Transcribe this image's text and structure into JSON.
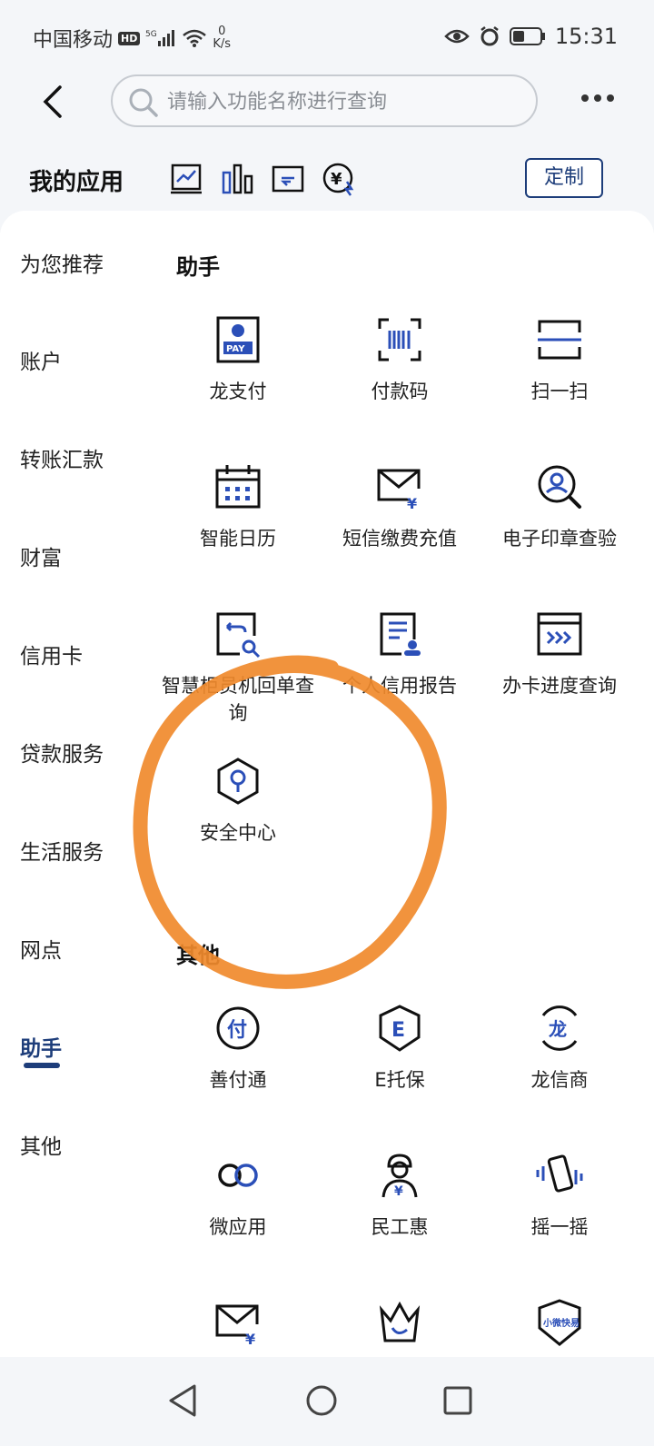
{
  "status_bar": {
    "carrier": "中国移动",
    "hd": "HD",
    "net_speed_value": "0",
    "net_speed_unit": "K/s",
    "time": "15:31"
  },
  "search": {
    "placeholder": "请输入功能名称进行查询"
  },
  "my_apps": {
    "title": "我的应用",
    "customize_label": "定制",
    "quick_icons": [
      "chart-line-icon",
      "bar-chart-icon",
      "transfer-icon",
      "yuan-exchange-icon"
    ]
  },
  "sidebar": {
    "items": [
      {
        "label": "为您推荐"
      },
      {
        "label": "账户"
      },
      {
        "label": "转账汇款"
      },
      {
        "label": "财富"
      },
      {
        "label": "信用卡"
      },
      {
        "label": "贷款服务"
      },
      {
        "label": "生活服务"
      },
      {
        "label": "网点"
      },
      {
        "label": "助手",
        "active": true
      },
      {
        "label": "其他"
      }
    ]
  },
  "sections": {
    "assistant": {
      "title": "助手",
      "items": [
        {
          "label": "龙支付",
          "icon": "long-pay-icon"
        },
        {
          "label": "付款码",
          "icon": "barcode-scan-icon"
        },
        {
          "label": "扫一扫",
          "icon": "scan-icon"
        },
        {
          "label": "智能日历",
          "icon": "calendar-icon"
        },
        {
          "label": "短信缴费充值",
          "icon": "sms-payment-icon"
        },
        {
          "label": "电子印章查验",
          "icon": "seal-verify-icon"
        },
        {
          "label": "智慧柜员机回单查询",
          "icon": "receipt-search-icon"
        },
        {
          "label": "个人信用报告",
          "icon": "credit-report-icon"
        },
        {
          "label": "办卡进度查询",
          "icon": "card-progress-icon"
        },
        {
          "label": "安全中心",
          "icon": "security-center-icon"
        }
      ]
    },
    "other": {
      "title": "其他",
      "items": [
        {
          "label": "善付通",
          "icon": "shanfutong-icon"
        },
        {
          "label": "E托保",
          "icon": "e-tuobao-icon"
        },
        {
          "label": "龙信商",
          "icon": "longxinshang-icon"
        },
        {
          "label": "微应用",
          "icon": "micro-app-icon"
        },
        {
          "label": "民工惠",
          "icon": "worker-icon"
        },
        {
          "label": "摇一摇",
          "icon": "shake-icon"
        },
        {
          "label": "",
          "icon": "mail-yuan-icon"
        },
        {
          "label": "",
          "icon": "crown-icon"
        },
        {
          "label": "小微快易",
          "icon": "xiaowei-kuaiyi-icon"
        }
      ]
    }
  },
  "colors": {
    "accent": "#1d3d7a",
    "icon_accent": "#2b4fb8",
    "annotation": "#f08a2c"
  }
}
